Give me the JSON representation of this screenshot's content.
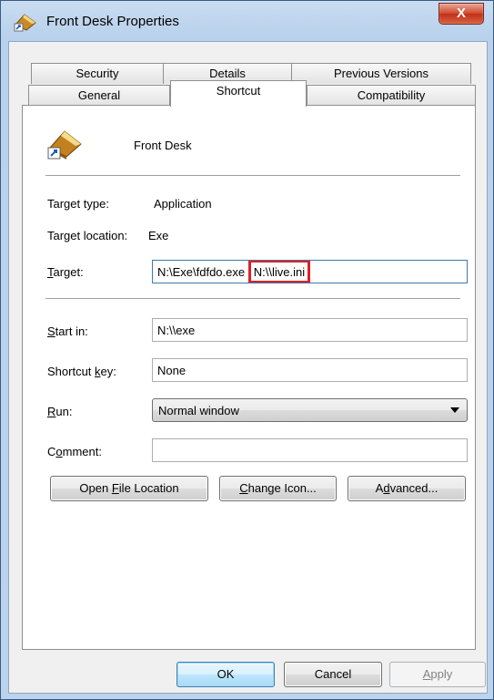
{
  "window": {
    "title": "Front Desk Properties",
    "close_glyph": "X"
  },
  "tabs_row1": [
    {
      "label": "Security"
    },
    {
      "label": "Details"
    },
    {
      "label": "Previous Versions"
    }
  ],
  "tabs_row2": [
    {
      "label": "General"
    },
    {
      "label": "Shortcut",
      "active": true
    },
    {
      "label": "Compatibility"
    }
  ],
  "shortcut": {
    "name": "Front Desk",
    "target_type_label": "Target type:",
    "target_type_value": "Application",
    "target_location_label": "Target location:",
    "target_location_value": "Exe",
    "target_label_u": "T",
    "target_label_rest": "arget:",
    "target_value_main": "N:\\Exe\\fdfdo.exe ",
    "target_value_highlight": "N:\\\\live.ini",
    "start_in_label_u": "S",
    "start_in_label_rest": "tart in:",
    "start_in_value": "N:\\\\exe",
    "shortcut_key_label_pre": "Shortcut ",
    "shortcut_key_label_u": "k",
    "shortcut_key_label_rest": "ey:",
    "shortcut_key_value": "None",
    "run_label_u": "R",
    "run_label_rest": "un:",
    "run_value": "Normal window",
    "comment_label_pre": "C",
    "comment_label_u": "o",
    "comment_label_rest": "mment:",
    "comment_value": ""
  },
  "buttons": {
    "open_file_location_pre": "Open ",
    "open_file_location_u": "F",
    "open_file_location_rest": "ile Location",
    "change_icon_u": "C",
    "change_icon_rest": "hange Icon...",
    "advanced_pre": "A",
    "advanced_u": "d",
    "advanced_rest": "vanced...",
    "ok": "OK",
    "cancel": "Cancel",
    "apply_u": "A",
    "apply_rest": "pply"
  },
  "colors": {
    "highlight_box": "#e01f26",
    "title_bar": "#c9dcf1"
  },
  "icons": {
    "title": "shortcut-app-icon",
    "shortcut": "app-shortcut-icon"
  }
}
